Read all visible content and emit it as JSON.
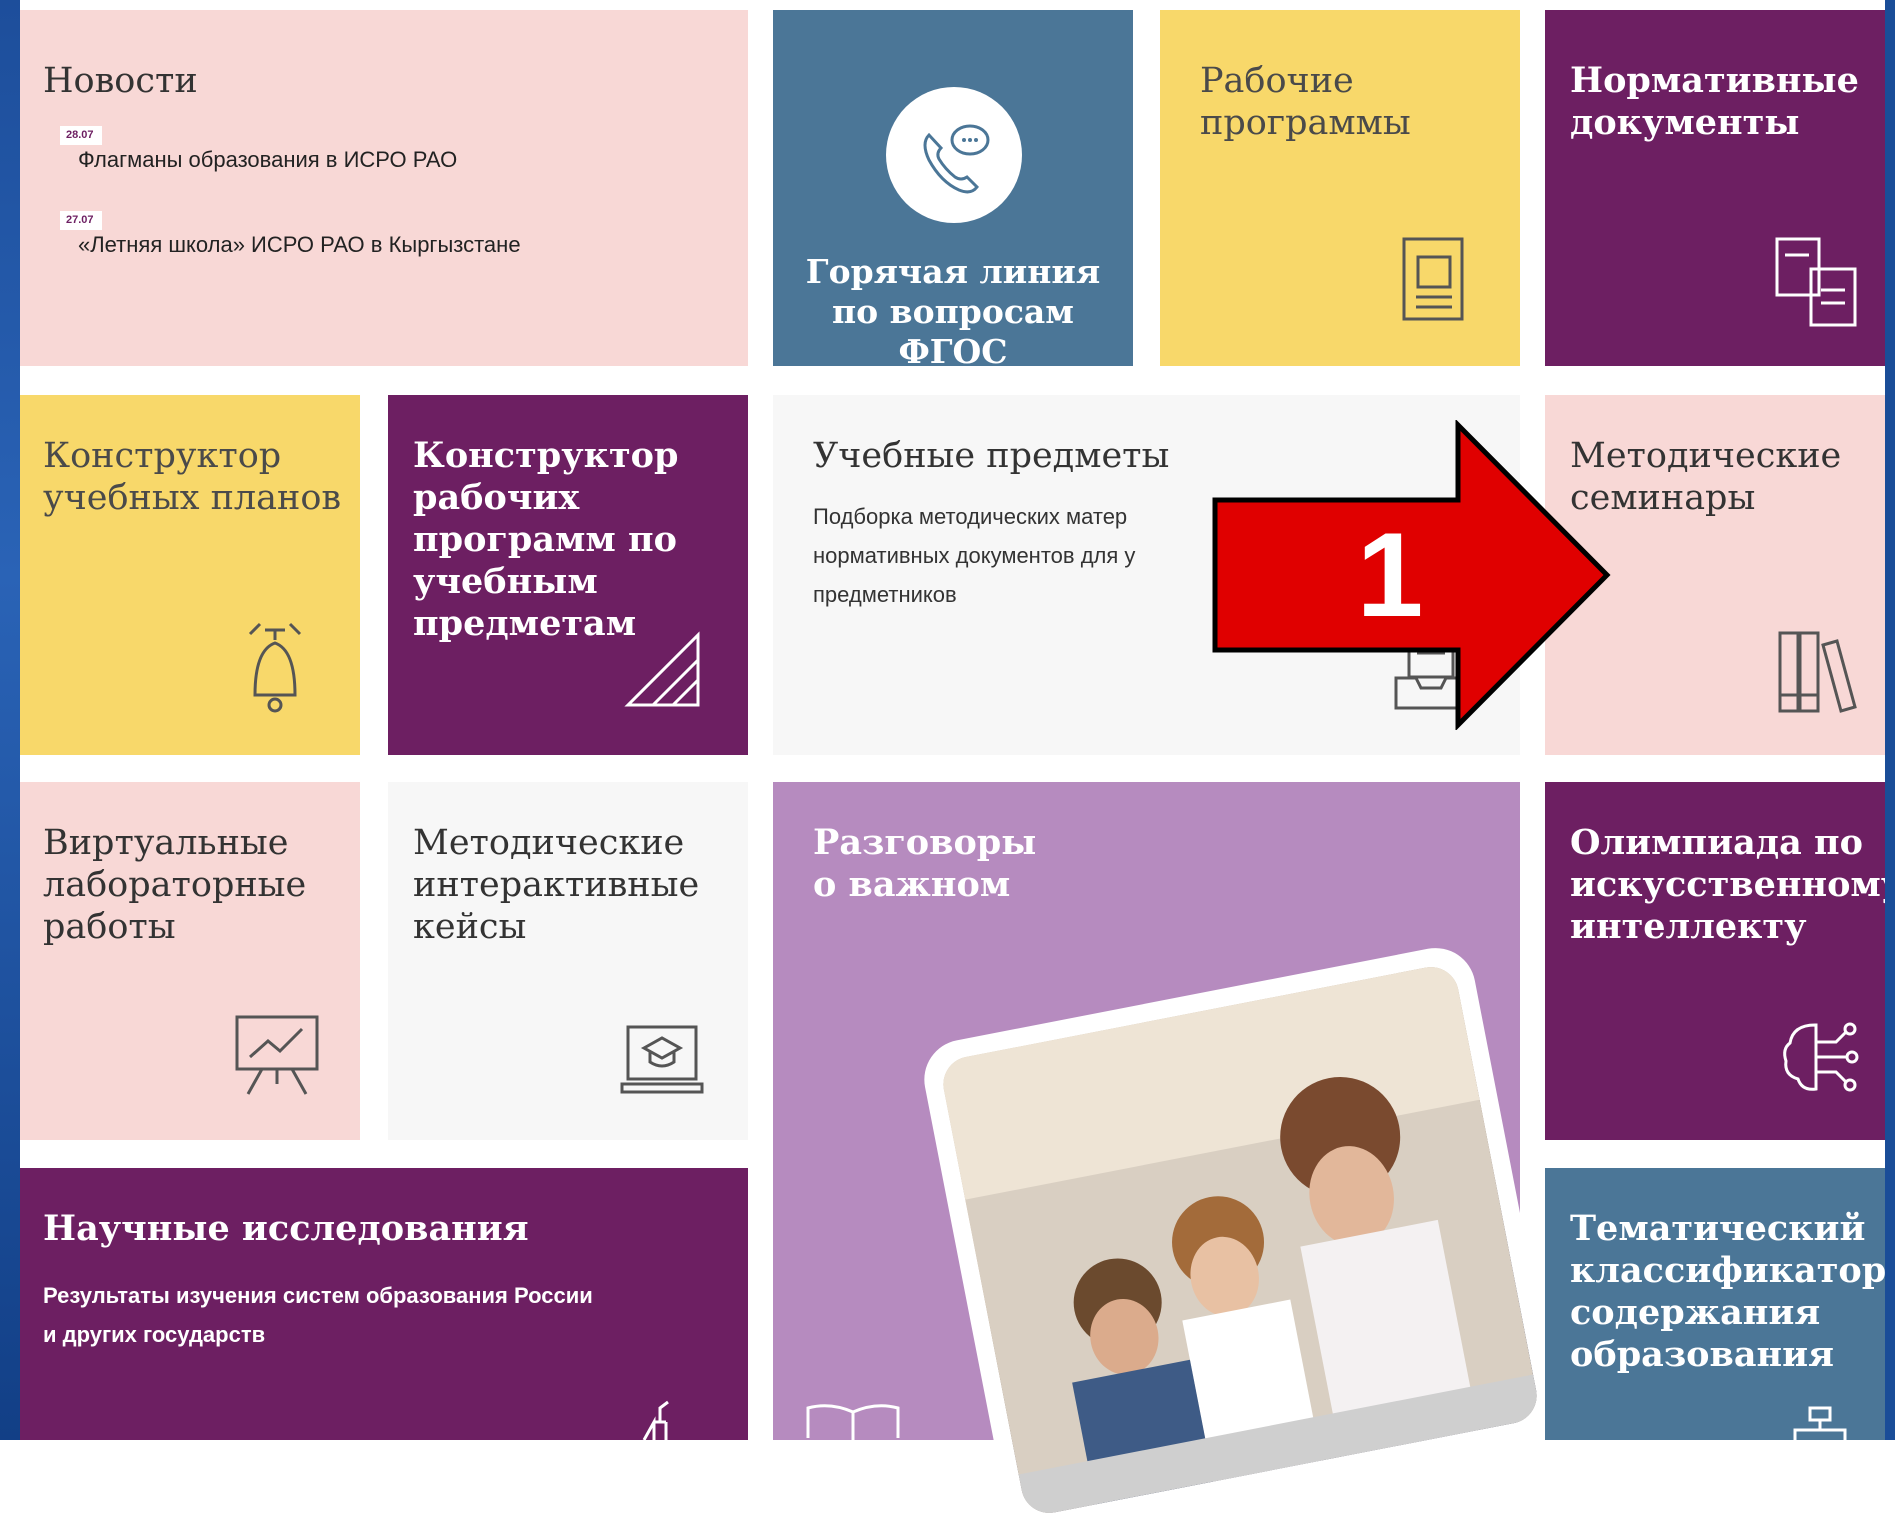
{
  "tiles": {
    "news": {
      "title": "Новости",
      "items": [
        {
          "date": "28.07",
          "text": "Флагманы образования в ИСРО РАО"
        },
        {
          "date": "27.07",
          "text": "«Летняя школа» ИСРО РАО в Кыргызстане"
        }
      ]
    },
    "hotline": {
      "title": "Горячая линия\nпо вопросам\nФГОС",
      "icon": "phone-chat-icon"
    },
    "work_programs": {
      "title": "Рабочие\nпрограммы",
      "icon": "document-icon"
    },
    "normative_docs": {
      "title": "Нормативные\nдокументы",
      "icon": "documents-icon"
    },
    "curriculum_builder": {
      "title": "Конструктор\nучебных планов",
      "icon": "bell-icon"
    },
    "work_program_builder": {
      "title": "Конструктор\nрабочих\nпрограмм по\nучебным\nпредметам",
      "icon": "ruler-triangle-icon"
    },
    "subjects": {
      "title": "Учебные предметы",
      "description_lines": [
        "Подборка методических матер",
        "нормативных документов для у",
        "предметников"
      ],
      "icon": "folder-tray-icon"
    },
    "method_seminars": {
      "title": "Методические\nсеминары",
      "icon": "books-icon"
    },
    "virtual_labs": {
      "title": "Виртуальные\nлабораторные\nработы",
      "icon": "presentation-board-icon"
    },
    "interactive_cases": {
      "title": "Методические\nинтерактивные\nкейсы",
      "icon": "laptop-graduation-icon"
    },
    "important_talks": {
      "title": "Разговоры\nо важном",
      "icon": "open-book-icon"
    },
    "ai_olympiad": {
      "title": "Олимпиада по\nискусственному\nинтеллекту",
      "icon": "ai-brain-icon"
    },
    "research": {
      "title": "Научные исследования",
      "description_lines": [
        "Результаты изучения систем образования России",
        "и других государств"
      ],
      "icon": "flask-icon"
    },
    "classifier": {
      "title": "Тематический\nклассификатор\nсодержания\nобразования",
      "icon": "structure-icon"
    }
  },
  "annotation": {
    "label": "1",
    "color": "#e00000"
  },
  "colors": {
    "pink": "#f8d8d6",
    "blue": "#4b7697",
    "yellow": "#f8d86a",
    "plum": "#6d1f62",
    "white": "#f7f7f7",
    "lilac": "#b68bbf"
  }
}
